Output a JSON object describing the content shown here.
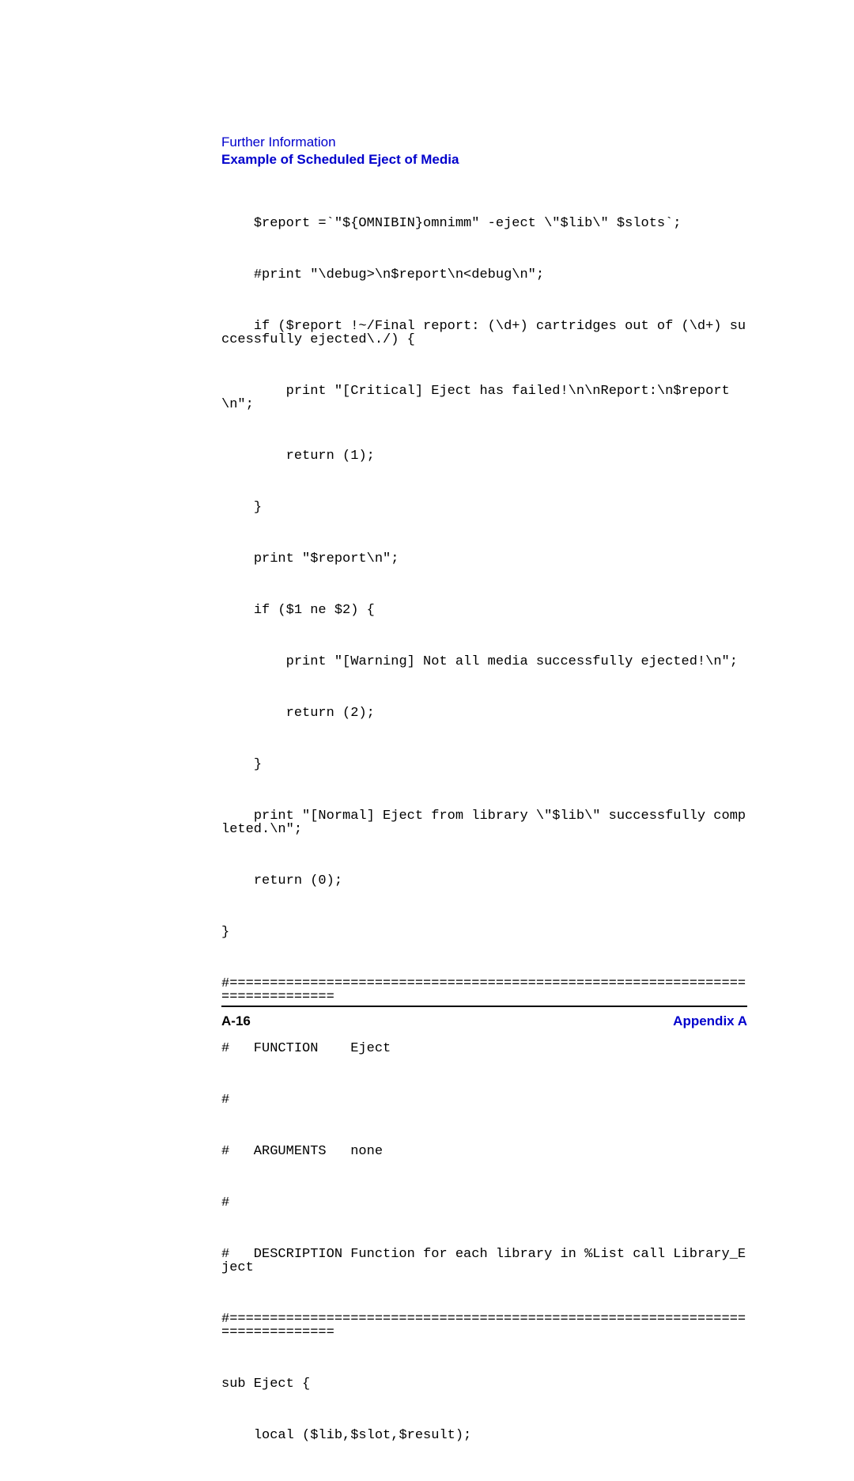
{
  "header": {
    "section_label": "Further Information",
    "section_title": "Example of Scheduled Eject of Media"
  },
  "code": {
    "l1": "    $report =`\"${OMNIBIN}omnimm\" -eject \\\"$lib\\\" $slots`;",
    "l2": "    #print \"\\debug>\\n$report\\n<debug\\n\";",
    "l3": "    if ($report !~/Final report: (\\d+) cartridges out of (\\d+) successfully ejected\\./) {",
    "l4": "        print \"[Critical] Eject has failed!\\n\\nReport:\\n$report\\n\";",
    "l5": "        return (1);",
    "l6": "    }",
    "l7": "    print \"$report\\n\";",
    "l8": "    if ($1 ne $2) {",
    "l9": "        print \"[Warning] Not all media successfully ejected!\\n\";",
    "l10": "        return (2);",
    "l11": "    }",
    "l12": "    print \"[Normal] Eject from library \\\"$lib\\\" successfully completed.\\n\";",
    "l13": "    return (0);",
    "l14": "}",
    "l15": "#==============================================================================",
    "l16": "#   FUNCTION    Eject",
    "l17": "#",
    "l18": "#   ARGUMENTS   none",
    "l19": "#",
    "l20": "#   DESCRIPTION Function for each library in %List call Library_Eject",
    "l21": "#==============================================================================",
    "l22": "sub Eject {",
    "l23": "    local ($lib,$slot,$result);"
  },
  "footer": {
    "page_num": "A-16",
    "appendix": "Appendix A"
  }
}
